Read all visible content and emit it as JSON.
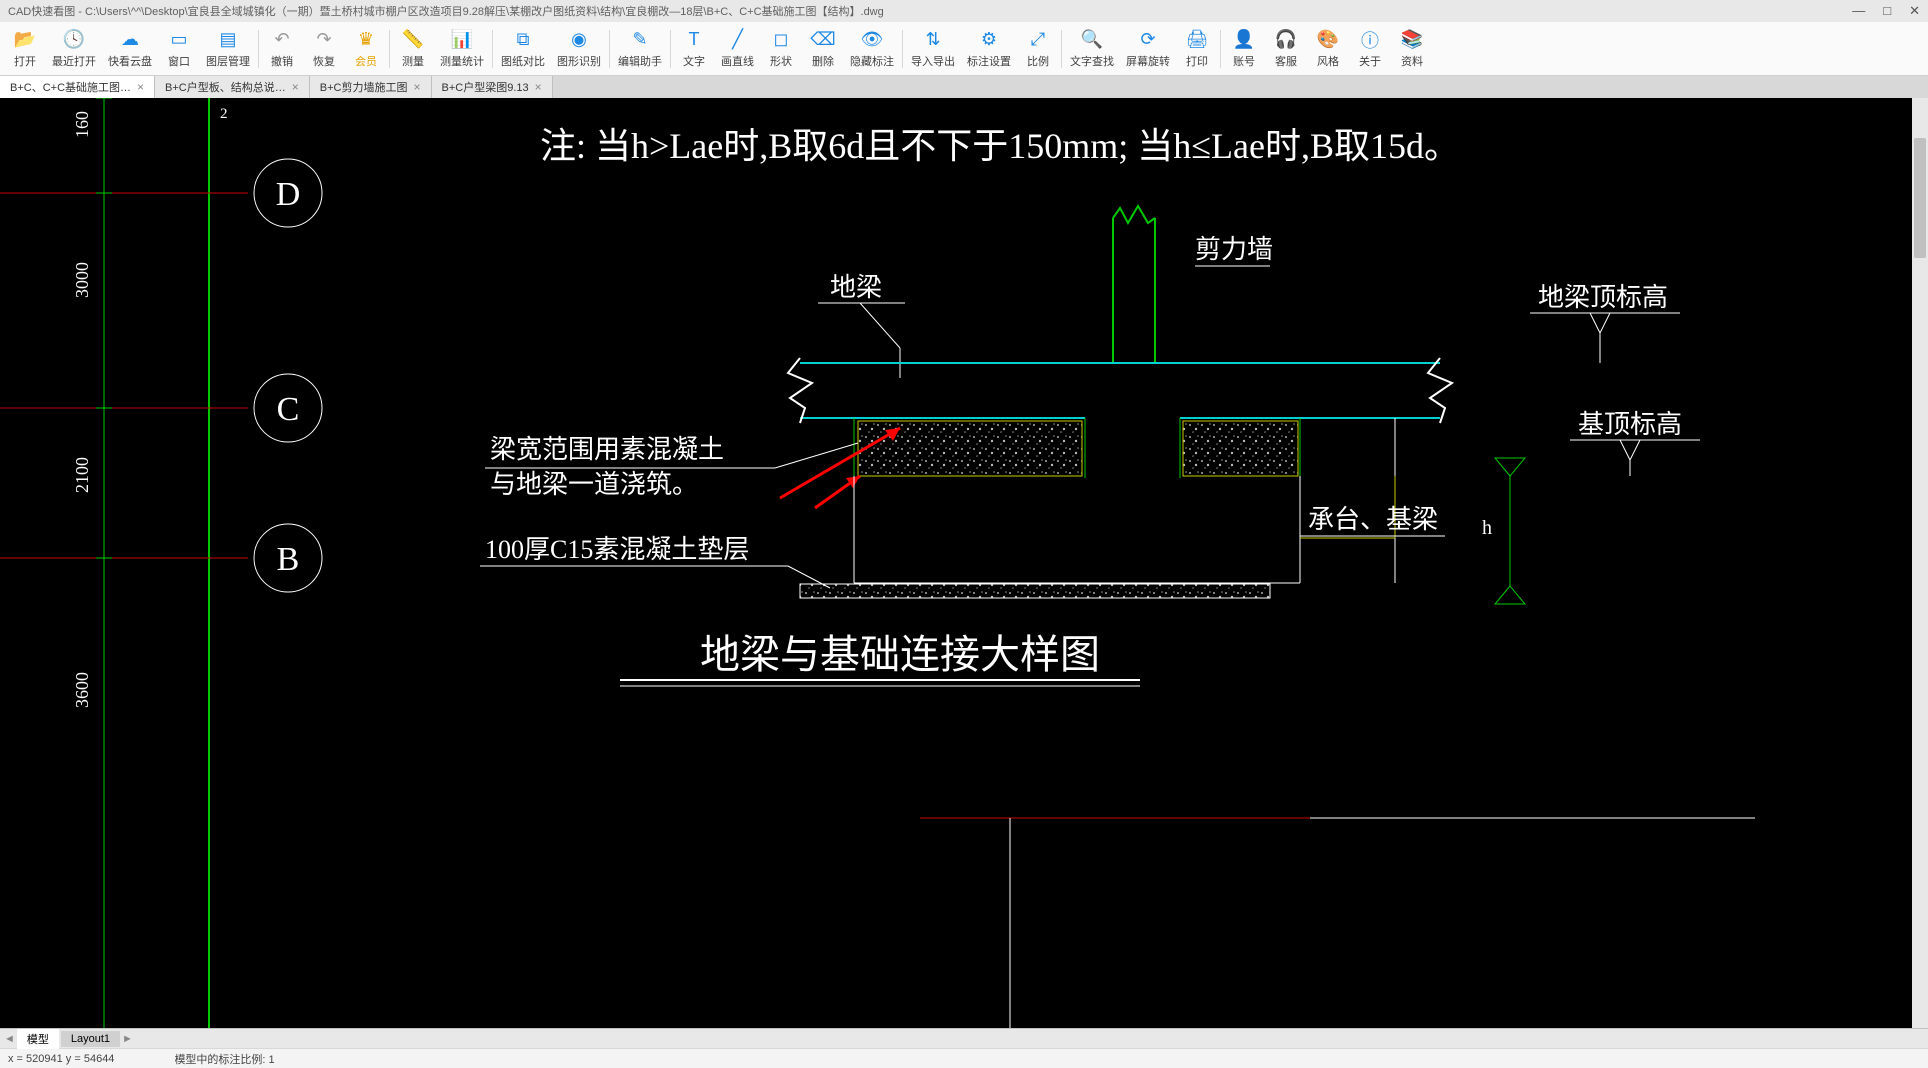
{
  "window": {
    "title": "CAD快速看图 - C:\\Users\\^^\\Desktop\\宜良县全域城镇化（一期）暨土桥村城市棚户区改造项目9.28解压\\某棚改户图纸资料\\结构\\宜良棚改—18层\\B+C、C+C基础施工图【结构】.dwg",
    "min": "—",
    "max": "□",
    "close": "✕"
  },
  "toolbar": {
    "open": "打开",
    "recent": "最近打开",
    "cloud": "快看云盘",
    "window": "窗口",
    "layers": "图层管理",
    "undo": "撤销",
    "redo": "恢复",
    "vip": "会员",
    "measure": "测量",
    "measure_stat": "测量统计",
    "compare": "图纸对比",
    "recognize": "图形识别",
    "edit_helper": "编辑助手",
    "text": "文字",
    "line": "画直线",
    "shape": "形状",
    "delete": "删除",
    "hide_annot": "隐藏标注",
    "import_export": "导入导出",
    "annot_settings": "标注设置",
    "scale": "比例",
    "text_search": "文字查找",
    "rotate": "屏幕旋转",
    "print": "打印",
    "account": "账号",
    "service": "客服",
    "style": "风格",
    "about": "关于",
    "material": "资料"
  },
  "tabs": [
    {
      "label": "B+C、C+C基础施工图…",
      "active": true
    },
    {
      "label": "B+C户型板、结构总说…",
      "active": false
    },
    {
      "label": "B+C剪力墙施工图",
      "active": false
    },
    {
      "label": "B+C户型梁图9.13",
      "active": false
    }
  ],
  "drawing": {
    "note": "注: 当h>Lae时,B取6d且不下于150mm; 当h≤Lae时,B取15d。",
    "shear_wall": "剪力墙",
    "ground_beam": "地梁",
    "beam_top_elev": "地梁顶标高",
    "concrete_note1": "梁宽范围用素混凝土",
    "concrete_note2": "与地梁一道浇筑。",
    "foundation_top_elev": "基顶标高",
    "cap_beam": "承台、基梁",
    "cushion": "100厚C15素混凝土垫层",
    "title": "地梁与基础连接大样图",
    "h": "h",
    "grid_b": "B",
    "grid_c": "C",
    "grid_d": "D",
    "dim_160": "160",
    "dim_3000": "3000",
    "dim_2100": "2100",
    "dim_3600": "3600",
    "dim_2": "2"
  },
  "layout": {
    "model": "模型",
    "layout1": "Layout1"
  },
  "status": {
    "coords": "x = 520941  y = 54644",
    "scale": "模型中的标注比例: 1"
  }
}
